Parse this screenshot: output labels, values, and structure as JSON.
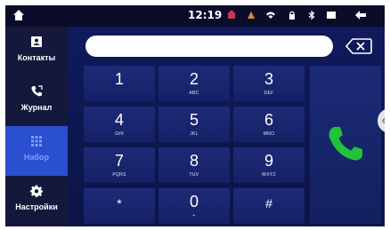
{
  "status": {
    "time": "12:19",
    "icons": [
      "home-icon",
      "app-icon",
      "cast-icon",
      "wifi-icon",
      "lock-icon",
      "bluetooth-icon",
      "window-icon",
      "back-icon"
    ]
  },
  "sidebar": {
    "items": [
      {
        "label": "Контакты",
        "icon": "contacts-icon",
        "active": false
      },
      {
        "label": "Журнал",
        "icon": "call-log-icon",
        "active": false
      },
      {
        "label": "Набор",
        "icon": "dialpad-icon",
        "active": true
      },
      {
        "label": "Настройки",
        "icon": "settings-icon",
        "active": false
      }
    ]
  },
  "dialer": {
    "input_value": "",
    "keys": [
      {
        "digit": "1",
        "letters": ""
      },
      {
        "digit": "2",
        "letters": "ABC"
      },
      {
        "digit": "3",
        "letters": "DEF"
      },
      {
        "digit": "4",
        "letters": "GHI"
      },
      {
        "digit": "5",
        "letters": "JKL"
      },
      {
        "digit": "6",
        "letters": "MNO"
      },
      {
        "digit": "7",
        "letters": "PQRS"
      },
      {
        "digit": "8",
        "letters": "TUV"
      },
      {
        "digit": "9",
        "letters": "WXYZ"
      },
      {
        "digit": "*",
        "letters": ""
      },
      {
        "digit": "0",
        "letters": "+"
      },
      {
        "digit": "#",
        "letters": ""
      }
    ],
    "call_color": "#22c23a"
  },
  "colors": {
    "background": "#0b0f33",
    "sidebar_active": "#2a4fd0",
    "key": "#1d2a78"
  }
}
